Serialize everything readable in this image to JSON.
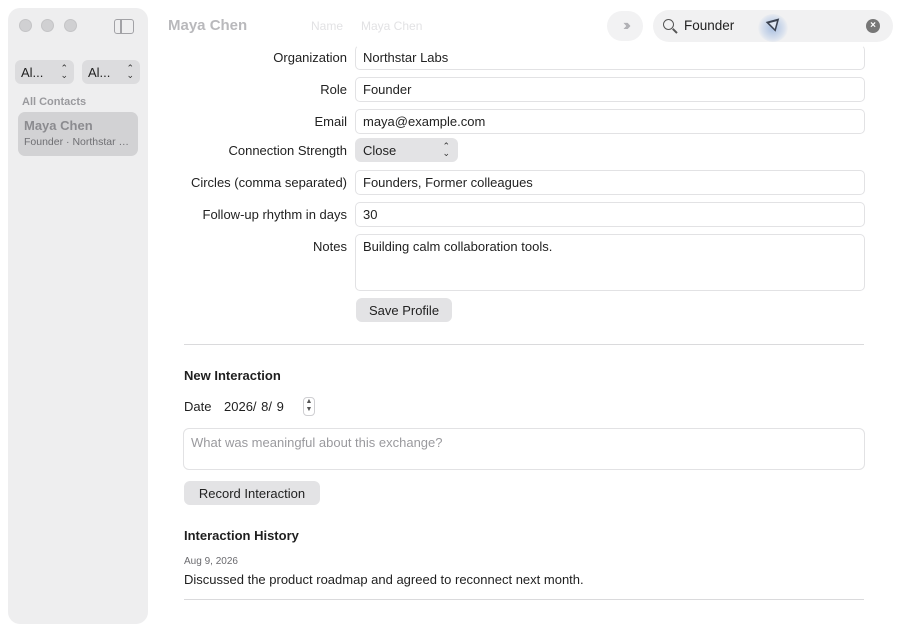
{
  "sidebar": {
    "filter_1": "Al...",
    "filter_2": "Al...",
    "section_label": "All Contacts",
    "contacts": [
      {
        "name": "Maya Chen",
        "subtitle": "Founder · Northstar Labs"
      }
    ]
  },
  "toolbar": {
    "title": "Maya Chen",
    "ghost_label": "Name",
    "ghost_value": "Maya Chen",
    "search_value": "Founder"
  },
  "profile": {
    "organization_label": "Organization",
    "organization_value": "Northstar Labs",
    "role_label": "Role",
    "role_value": "Founder",
    "email_label": "Email",
    "email_value": "maya@example.com",
    "strength_label": "Connection Strength",
    "strength_value": "Close",
    "circles_label": "Circles (comma separated)",
    "circles_value": "Founders, Former colleagues",
    "rhythm_label": "Follow-up rhythm in days",
    "rhythm_value": "30",
    "notes_label": "Notes",
    "notes_value": "Building calm collaboration tools.",
    "save_label": "Save Profile"
  },
  "interaction": {
    "title": "New Interaction",
    "date_label": "Date",
    "date_value": "2026/ 8/ 9",
    "placeholder": "What was meaningful about this exchange?",
    "record_label": "Record Interaction"
  },
  "history": {
    "title": "Interaction History",
    "items": [
      {
        "date": "Aug 9, 2026",
        "text": "Discussed the product roadmap and agreed to reconnect next month."
      }
    ]
  }
}
